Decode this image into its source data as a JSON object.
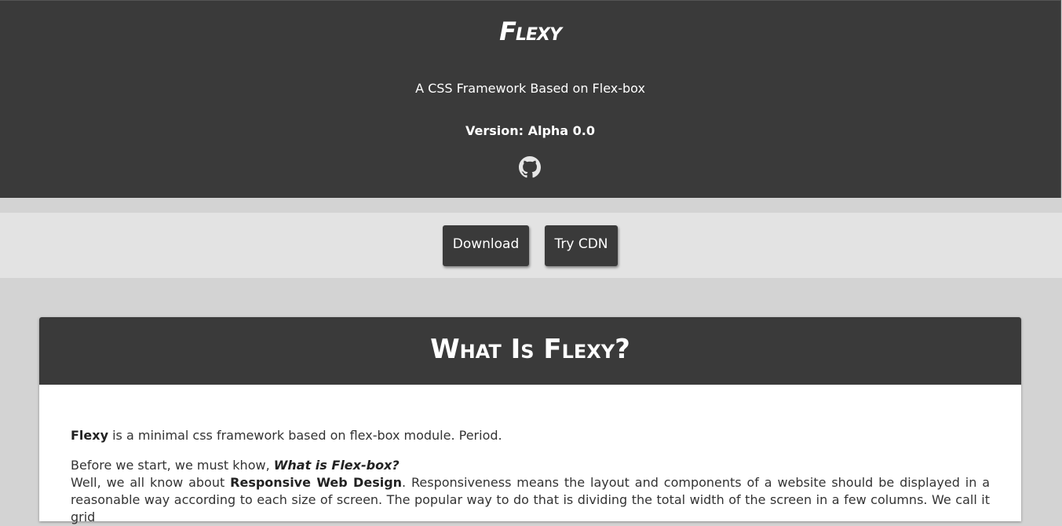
{
  "header": {
    "brand": "Flexy",
    "tagline": "A CSS Framework Based on Flex-box",
    "version_label": "Version: Alpha 0.0"
  },
  "actions": {
    "download_label": "Download",
    "cdn_label": "Try CDN"
  },
  "section": {
    "title": "What Is Flexy?",
    "p1_bold": "Flexy",
    "p1_rest": " is a minimal css framework based on flex-box module. Period.",
    "p2_lead": "Before we start, we must khow, ",
    "p2_question": "What is Flex-box?",
    "p3_lead": "Well, we all know about ",
    "p3_bold": "Responsive Web Design",
    "p3_rest": ". Responsiveness means the layout and components of a website should be displayed in a reasonable way according to each size of screen. The popular way to do that is dividing the total width of the screen in a few columns. We call it grid"
  },
  "colors": {
    "dark": "#3a3a3a",
    "page_bg": "#d3d3d3",
    "bar_bg": "#e3e3e3",
    "text": "#333333"
  },
  "icons": {
    "repo": "github-icon"
  }
}
